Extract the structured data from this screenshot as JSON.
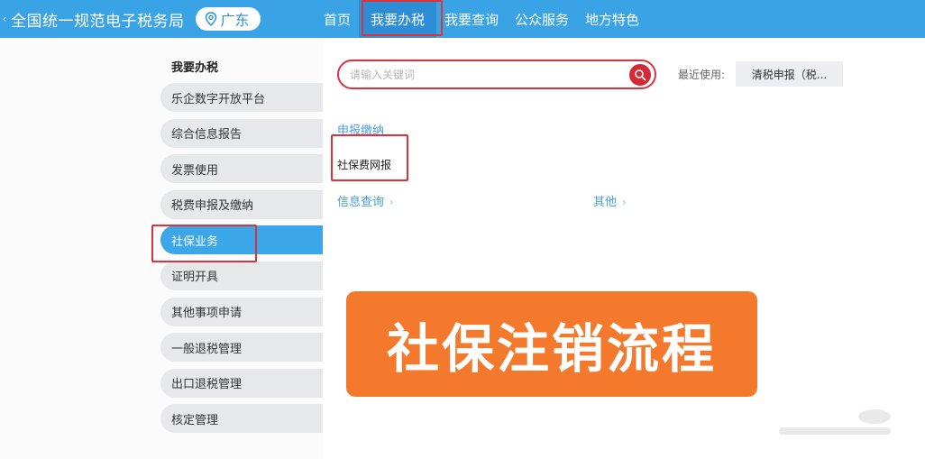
{
  "header": {
    "arrow": "‹",
    "site_title": "全国统一规范电子税务局",
    "region": "广东",
    "nav": [
      {
        "label": "首页"
      },
      {
        "label": "我要办税"
      },
      {
        "label": "我要查询"
      },
      {
        "label": "公众服务"
      },
      {
        "label": "地方特色"
      }
    ]
  },
  "sidebar": {
    "title": "我要办税",
    "items": [
      {
        "label": "乐企数字开放平台"
      },
      {
        "label": "综合信息报告"
      },
      {
        "label": "发票使用"
      },
      {
        "label": "税费申报及缴纳"
      },
      {
        "label": "社保业务"
      },
      {
        "label": "证明开具"
      },
      {
        "label": "其他事项申请"
      },
      {
        "label": "一般退税管理"
      },
      {
        "label": "出口退税管理"
      },
      {
        "label": "核定管理"
      }
    ]
  },
  "search": {
    "placeholder": "请输入关键词",
    "recent_label": "最近使用:",
    "recent_item": "清税申报（税..."
  },
  "content": {
    "section_title": "申报缴纳",
    "service_item": "社保费网报",
    "more_links": [
      {
        "label": "信息查询"
      },
      {
        "label": "其他"
      }
    ]
  },
  "banner": {
    "text": "社保注销流程"
  },
  "colors": {
    "header_bg": "#3aa3e6",
    "nav_active_bg": "#2e8ed5",
    "sidebar_active": "#3ba6e8",
    "highlight_red": "#e0303a",
    "search_button": "#d22a36",
    "banner_orange": "#f5792c"
  }
}
